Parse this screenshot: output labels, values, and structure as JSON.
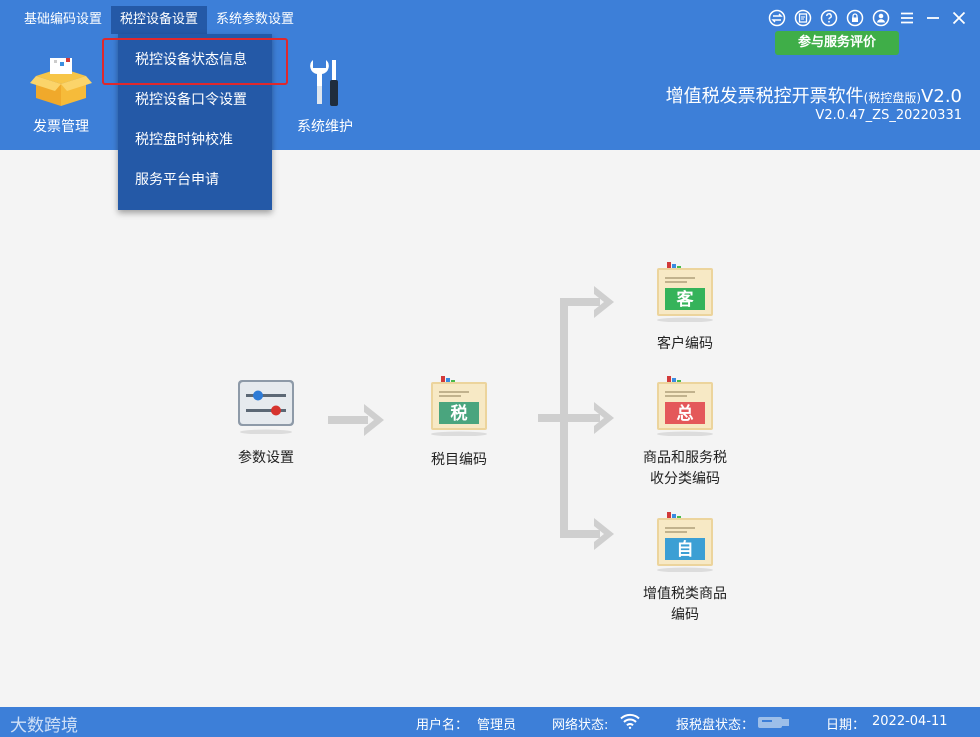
{
  "menubar": {
    "items": [
      "基础编码设置",
      "税控设备设置",
      "系统参数设置"
    ]
  },
  "dropdown": {
    "items": [
      "税控设备状态信息",
      "税控设备口令设置",
      "税控盘时钟校准",
      "服务平台申请"
    ]
  },
  "header": {
    "rate_button": "参与服务评价",
    "tool_invoice": "发票管理",
    "tool_maintenance": "系统维护",
    "title_main": "增值税发票税控开票软件",
    "title_edition": "(税控盘版)",
    "title_suffix": "V2.0",
    "version": "V2.0.47_ZS_20220331"
  },
  "flow": {
    "params": "参数设置",
    "tax_items": "税目编码",
    "tax_items_badge": "税",
    "customer": "客户编码",
    "customer_badge": "客",
    "goods_line1": "商品和服务税",
    "goods_line2": "收分类编码",
    "goods_badge": "总",
    "vat_line1": "增值税类商品",
    "vat_line2": "编码",
    "vat_badge": "自"
  },
  "footer": {
    "brand": "大数跨境",
    "user_label": "用户名：",
    "user_value": "管理员",
    "network_label": "网络状态:",
    "disk_label": "报税盘状态：",
    "date_label": "日期：",
    "date_value": "2022-04-11"
  }
}
